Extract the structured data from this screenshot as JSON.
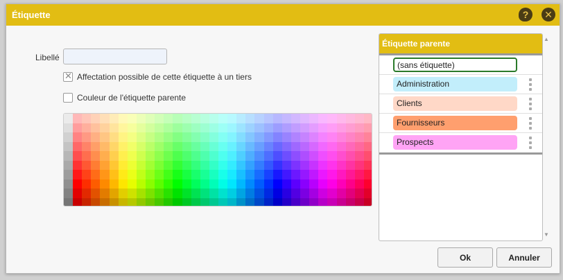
{
  "dialog": {
    "title": "Étiquette",
    "help_icon": "?",
    "close_icon": "✕"
  },
  "form": {
    "label_text": "Libellé",
    "label_value": "",
    "checkbox_third_party": {
      "label": "Affectation possible de cette étiquette à un tiers",
      "checked": true
    },
    "checkbox_parent_color": {
      "label": "Couleur de l'étiquette parente",
      "checked": false
    }
  },
  "parent_panel": {
    "header": "Étiquette parente",
    "items": [
      {
        "label": "(sans étiquette)",
        "color": "#ffffff",
        "selected": true
      },
      {
        "label": "Administration",
        "color": "#c2eefb"
      },
      {
        "label": "Clients",
        "color": "#ffd8c7"
      },
      {
        "label": "Fournisseurs",
        "color": "#ff9f6e"
      },
      {
        "label": "Prospects",
        "color": "#ffa4f5"
      }
    ]
  },
  "buttons": {
    "ok": "Ok",
    "cancel": "Annuler"
  },
  "colors": {
    "accent": "#e2bd13",
    "selected_border": "#2a7a2a"
  }
}
